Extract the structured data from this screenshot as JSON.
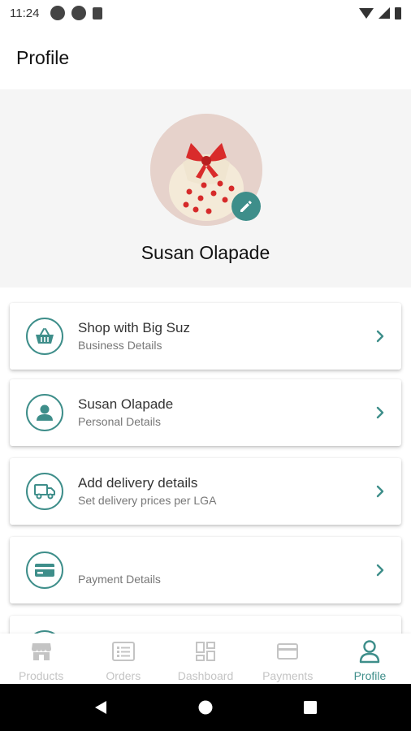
{
  "status_bar": {
    "time": "11:24"
  },
  "app_bar": {
    "title": "Profile"
  },
  "profile": {
    "name": "Susan Olapade"
  },
  "cards": [
    {
      "icon": "basket-icon",
      "title": "Shop with Big Suz",
      "subtitle": "Business Details"
    },
    {
      "icon": "person-icon",
      "title": "Susan Olapade",
      "subtitle": "Personal Details"
    },
    {
      "icon": "truck-icon",
      "title": "Add delivery details",
      "subtitle": "Set delivery prices per LGA"
    },
    {
      "icon": "credit-card-icon",
      "title": "",
      "subtitle": "Payment Details"
    }
  ],
  "bottom_nav": {
    "items": [
      {
        "label": "Products",
        "icon": "store-icon",
        "active": false
      },
      {
        "label": "Orders",
        "icon": "list-icon",
        "active": false
      },
      {
        "label": "Dashboard",
        "icon": "dashboard-icon",
        "active": false
      },
      {
        "label": "Payments",
        "icon": "card-icon",
        "active": false
      },
      {
        "label": "Profile",
        "icon": "profile-icon",
        "active": true
      }
    ]
  },
  "colors": {
    "accent": "#3e8e8a",
    "inactive": "#c4c4c4",
    "header_bg": "#f5f5f5"
  }
}
